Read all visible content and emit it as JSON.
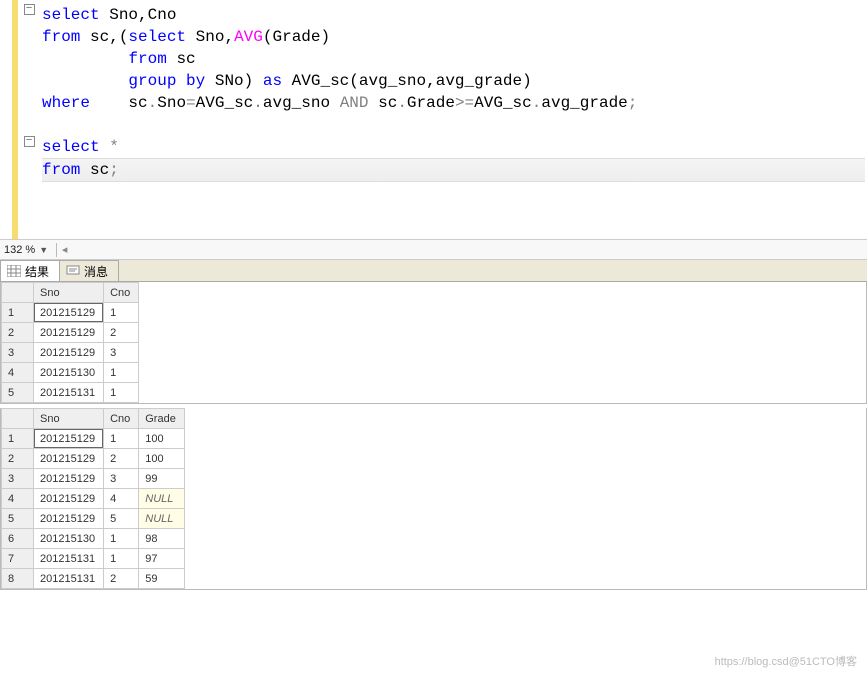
{
  "code_lines": [
    [
      {
        "t": "select ",
        "c": "kw"
      },
      {
        "t": "Sno"
      },
      {
        "t": ","
      },
      {
        "t": "Cno"
      }
    ],
    [
      {
        "t": "from ",
        "c": "kw"
      },
      {
        "t": "sc"
      },
      {
        "t": ",("
      },
      {
        "t": "select ",
        "c": "kw"
      },
      {
        "t": "Sno"
      },
      {
        "t": ","
      },
      {
        "t": "AVG",
        "c": "fn"
      },
      {
        "t": "("
      },
      {
        "t": "Grade"
      },
      {
        "t": ")"
      }
    ],
    [
      {
        "t": "         "
      },
      {
        "t": "from ",
        "c": "kw"
      },
      {
        "t": "sc"
      }
    ],
    [
      {
        "t": "         "
      },
      {
        "t": "group by ",
        "c": "kw"
      },
      {
        "t": "SNo"
      },
      {
        "t": ") ",
        "c": ""
      },
      {
        "t": "as ",
        "c": "kw"
      },
      {
        "t": "AVG_sc"
      },
      {
        "t": "("
      },
      {
        "t": "avg_sno"
      },
      {
        "t": ","
      },
      {
        "t": "avg_grade"
      },
      {
        "t": ")"
      }
    ],
    [
      {
        "t": "where    ",
        "c": "kw"
      },
      {
        "t": "sc"
      },
      {
        "t": ".",
        "c": "gray"
      },
      {
        "t": "Sno"
      },
      {
        "t": "=",
        "c": "gray"
      },
      {
        "t": "AVG_sc"
      },
      {
        "t": ".",
        "c": "gray"
      },
      {
        "t": "avg_sno"
      },
      {
        "t": " AND ",
        "c": "gray"
      },
      {
        "t": "sc"
      },
      {
        "t": ".",
        "c": "gray"
      },
      {
        "t": "Grade"
      },
      {
        "t": ">=",
        "c": "gray"
      },
      {
        "t": "AVG_sc"
      },
      {
        "t": ".",
        "c": "gray"
      },
      {
        "t": "avg_grade"
      },
      {
        "t": ";",
        "c": "gray"
      }
    ],
    [],
    [
      {
        "t": "select ",
        "c": "kw"
      },
      {
        "t": "*",
        "c": "gray"
      }
    ],
    [
      {
        "t": "from ",
        "c": "kw"
      },
      {
        "t": "sc"
      },
      {
        "t": ";",
        "c": "gray"
      }
    ]
  ],
  "fold_marks": {
    "0": "-",
    "6": "-"
  },
  "cursor_line_index": 7,
  "zoom_level": "132 %",
  "tabs": {
    "results": "结果",
    "messages": "消息"
  },
  "table1": {
    "headers": [
      "Sno",
      "Cno"
    ],
    "rows": [
      {
        "n": "1",
        "Sno": "201215129",
        "Cno": "1",
        "sel": true
      },
      {
        "n": "2",
        "Sno": "201215129",
        "Cno": "2"
      },
      {
        "n": "3",
        "Sno": "201215129",
        "Cno": "3"
      },
      {
        "n": "4",
        "Sno": "201215130",
        "Cno": "1"
      },
      {
        "n": "5",
        "Sno": "201215131",
        "Cno": "1"
      }
    ]
  },
  "table2": {
    "headers": [
      "Sno",
      "Cno",
      "Grade"
    ],
    "rows": [
      {
        "n": "1",
        "Sno": "201215129",
        "Cno": "1",
        "Grade": "100",
        "sel": true
      },
      {
        "n": "2",
        "Sno": "201215129",
        "Cno": "2",
        "Grade": "100"
      },
      {
        "n": "3",
        "Sno": "201215129",
        "Cno": "3",
        "Grade": "99"
      },
      {
        "n": "4",
        "Sno": "201215129",
        "Cno": "4",
        "Grade": "NULL",
        "null": true
      },
      {
        "n": "5",
        "Sno": "201215129",
        "Cno": "5",
        "Grade": "NULL",
        "null": true
      },
      {
        "n": "6",
        "Sno": "201215130",
        "Cno": "1",
        "Grade": "98"
      },
      {
        "n": "7",
        "Sno": "201215131",
        "Cno": "1",
        "Grade": "97"
      },
      {
        "n": "8",
        "Sno": "201215131",
        "Cno": "2",
        "Grade": "59"
      }
    ]
  },
  "watermark": "https://blog.csd@51CTO博客"
}
